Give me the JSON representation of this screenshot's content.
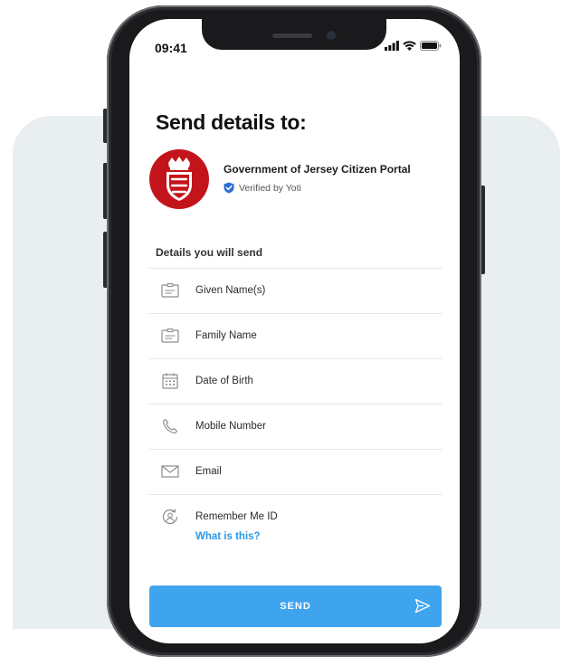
{
  "status_bar": {
    "time": "09:41"
  },
  "header": {
    "title": "Send details to:"
  },
  "organisation": {
    "name": "Government of Jersey Citizen Portal",
    "verified_label": "Verified by Yoti",
    "logo_color": "#c4141b"
  },
  "details": {
    "section_label": "Details you will send",
    "items": [
      {
        "label": "Given Name(s)",
        "icon": "id-card-icon"
      },
      {
        "label": "Family Name",
        "icon": "id-card-icon"
      },
      {
        "label": "Date of Birth",
        "icon": "calendar-icon"
      },
      {
        "label": "Mobile Number",
        "icon": "phone-icon"
      },
      {
        "label": "Email",
        "icon": "envelope-icon"
      },
      {
        "label": "Remember Me ID",
        "icon": "user-refresh-icon"
      }
    ],
    "info_link": "What is this?"
  },
  "actions": {
    "send_label": "SEND"
  },
  "colors": {
    "accent": "#3fa4ee",
    "link": "#2b97e6",
    "verified_badge": "#2b6fd6",
    "backdrop": "#e9eef0"
  }
}
